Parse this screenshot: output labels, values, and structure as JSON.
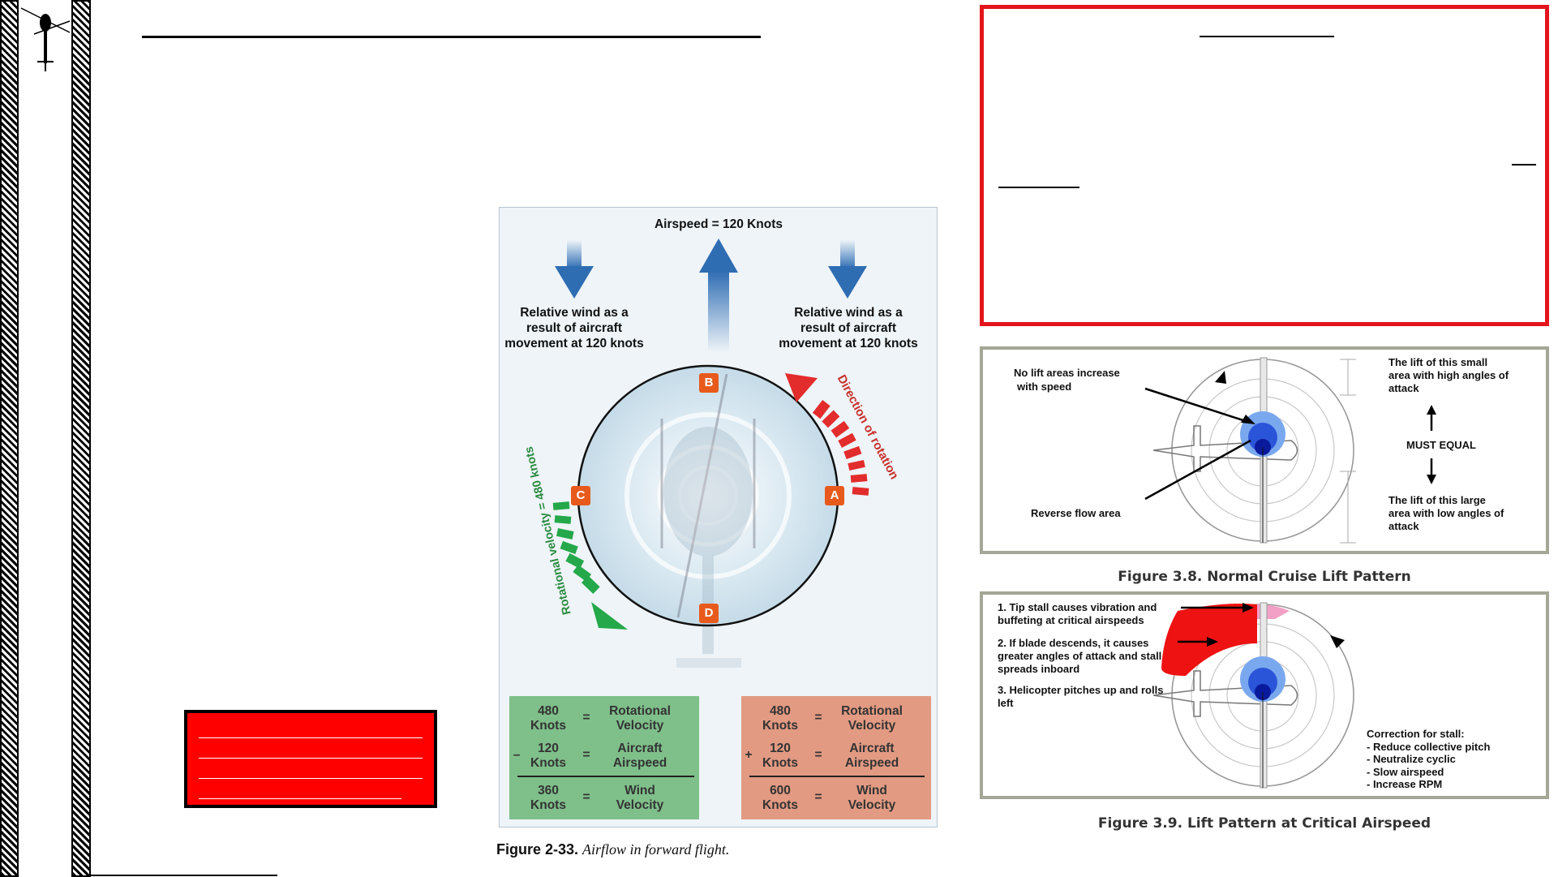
{
  "fig233": {
    "airspeed": "Airspeed = 120 Knots",
    "rel_wind_left": [
      "Relative wind as a",
      "result of aircraft",
      "movement at 120 knots"
    ],
    "rel_wind_right": [
      "Relative wind as a",
      "result of aircraft",
      "movement at 120 knots"
    ],
    "direction_of_rotation": "Direction of rotation",
    "rotational_velocity": "Rotational velocity = 480 knots",
    "points": {
      "a": "A",
      "b": "B",
      "c": "C",
      "d": "D"
    },
    "left_table": {
      "r1": {
        "num": "480",
        "unit": "Knots",
        "op": "",
        "eq": "=",
        "w1": "Rotational",
        "w2": "Velocity"
      },
      "r2": {
        "num": "120",
        "unit": "Knots",
        "op": "–",
        "eq": "=",
        "w1": "Aircraft",
        "w2": "Airspeed"
      },
      "r3": {
        "num": "360",
        "unit": "Knots",
        "op": "",
        "eq": "=",
        "w1": "Wind",
        "w2": "Velocity"
      }
    },
    "right_table": {
      "r1": {
        "num": "480",
        "unit": "Knots",
        "op": "",
        "eq": "=",
        "w1": "Rotational",
        "w2": "Velocity"
      },
      "r2": {
        "num": "120",
        "unit": "Knots",
        "op": "+",
        "eq": "=",
        "w1": "Aircraft",
        "w2": "Airspeed"
      },
      "r3": {
        "num": "600",
        "unit": "Knots",
        "op": "",
        "eq": "=",
        "w1": "Wind",
        "w2": "Velocity"
      }
    },
    "caption_num": "Figure 2-33.",
    "caption_text": "Airflow in forward flight."
  },
  "fig38": {
    "no_lift": [
      "No lift areas increase",
      "with speed"
    ],
    "reverse_flow": "Reverse flow area",
    "small_area": [
      "The lift of this small",
      "area with high angles of",
      "attack"
    ],
    "must_equal": "MUST EQUAL",
    "large_area": [
      "The lift of this large",
      "area with low angles of",
      "attack"
    ],
    "caption": "Figure 3.8. Normal Cruise Lift Pattern"
  },
  "fig39": {
    "item1": [
      "1. Tip stall causes vibration and",
      "buffeting at critical airspeeds"
    ],
    "item2": [
      "2. If blade descends, it causes",
      "greater angles of attack and stall",
      "spreads inboard"
    ],
    "item3": [
      "3. Helicopter pitches up and rolls",
      "left"
    ],
    "correction": [
      "Correction for stall:",
      "- Reduce collective pitch",
      "- Neutralize cyclic",
      "- Slow airspeed",
      "- Increase RPM"
    ],
    "caption": "Figure 3.9. Lift Pattern at Critical Airspeed"
  },
  "colors": {
    "alert_red": "#ff0000",
    "figure_bg": "#eef4f8",
    "blue_arrow": "#2f6db3",
    "red_arrow": "#e32c2c",
    "green_arrow": "#24a84a",
    "table_green": "#7fbf8a",
    "table_red": "#e29a82",
    "panel_border": "#a4a796"
  },
  "icons": [
    "helicopter-icon"
  ]
}
